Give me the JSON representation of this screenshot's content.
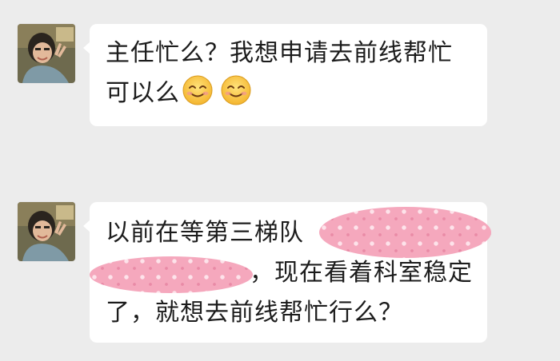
{
  "messages": [
    {
      "sender": "avatar",
      "lines": [
        "主任忙么？我想申请去前线帮忙",
        "可以么"
      ],
      "emoji": [
        "smiling-face-icon",
        "smiling-face-icon"
      ]
    },
    {
      "sender": "avatar",
      "lines": [
        "以前在等第三梯队",
        "，现在看着科室稳定",
        "了，就想去前线帮忙行么？"
      ],
      "redactions": [
        "pink-sticker-redaction",
        "pink-sticker-redaction"
      ]
    }
  ],
  "colors": {
    "background": "#ececec",
    "bubble": "#ffffff",
    "text": "#1c1c1c",
    "redaction": "#f5a8bd"
  }
}
